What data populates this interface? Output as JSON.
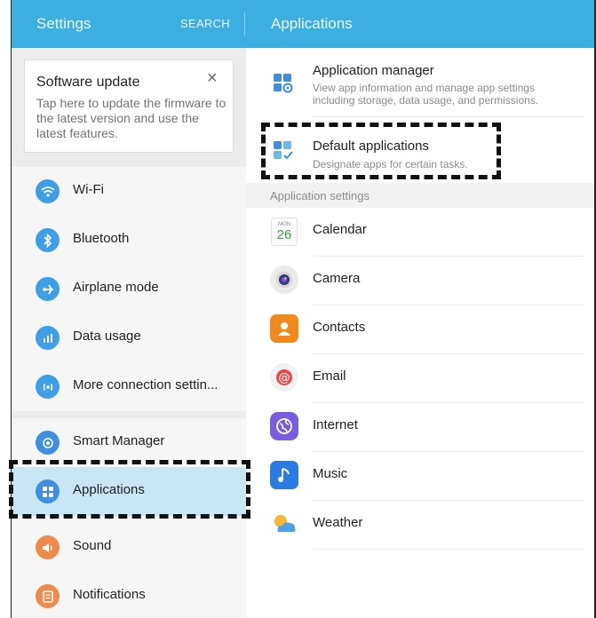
{
  "header": {
    "left_title": "Settings",
    "search_label": "SEARCH",
    "right_title": "Applications"
  },
  "update_card": {
    "title": "Software update",
    "text": "Tap here to update the firmware to the latest version and use the latest features.",
    "close_glyph": "×"
  },
  "menu": {
    "group1": [
      {
        "label": "Wi-Fi",
        "icon": "wifi-icon",
        "color": "#3f9fe6",
        "glyph": "≋"
      },
      {
        "label": "Bluetooth",
        "icon": "bluetooth-icon",
        "color": "#3f9fe6",
        "glyph": "✱"
      },
      {
        "label": "Airplane mode",
        "icon": "airplane-icon",
        "color": "#3f9fe6",
        "glyph": "✈"
      },
      {
        "label": "Data usage",
        "icon": "data-usage-icon",
        "color": "#3f9fe6",
        "glyph": "▮"
      },
      {
        "label": "More connection settin...",
        "icon": "connection-icon",
        "color": "#3f9fe6",
        "glyph": "◉"
      }
    ],
    "group2": [
      {
        "label": "Smart Manager",
        "icon": "smart-manager-icon",
        "color": "#3f8ee0",
        "glyph": "◎"
      },
      {
        "label": "Applications",
        "icon": "applications-icon",
        "color": "#3f8ee0",
        "glyph": "⊞",
        "selected": true
      },
      {
        "label": "Sound",
        "icon": "sound-icon",
        "color": "#f08a4b",
        "glyph": "◀"
      },
      {
        "label": "Notifications",
        "icon": "notifications-icon",
        "color": "#f08a4b",
        "glyph": "▤"
      }
    ]
  },
  "right": {
    "app_manager": {
      "title": "Application manager",
      "subtitle": "View app information and manage app settings including storage, data usage, and permissions."
    },
    "default_apps": {
      "title": "Default applications",
      "subtitle": "Designate apps for certain tasks."
    },
    "section_title": "Application settings",
    "apps": [
      {
        "label": "Calendar",
        "icon": "calendar-icon",
        "badge_top": "MON",
        "badge_num": "26"
      },
      {
        "label": "Camera",
        "icon": "camera-icon"
      },
      {
        "label": "Contacts",
        "icon": "contacts-icon"
      },
      {
        "label": "Email",
        "icon": "email-icon"
      },
      {
        "label": "Internet",
        "icon": "internet-icon"
      },
      {
        "label": "Music",
        "icon": "music-icon"
      },
      {
        "label": "Weather",
        "icon": "weather-icon"
      }
    ]
  },
  "colors": {
    "topbar": "#3daee0",
    "selected_row": "#c8e6f4",
    "accent_blue": "#3f9fe6",
    "accent_orange": "#f08a4b"
  }
}
